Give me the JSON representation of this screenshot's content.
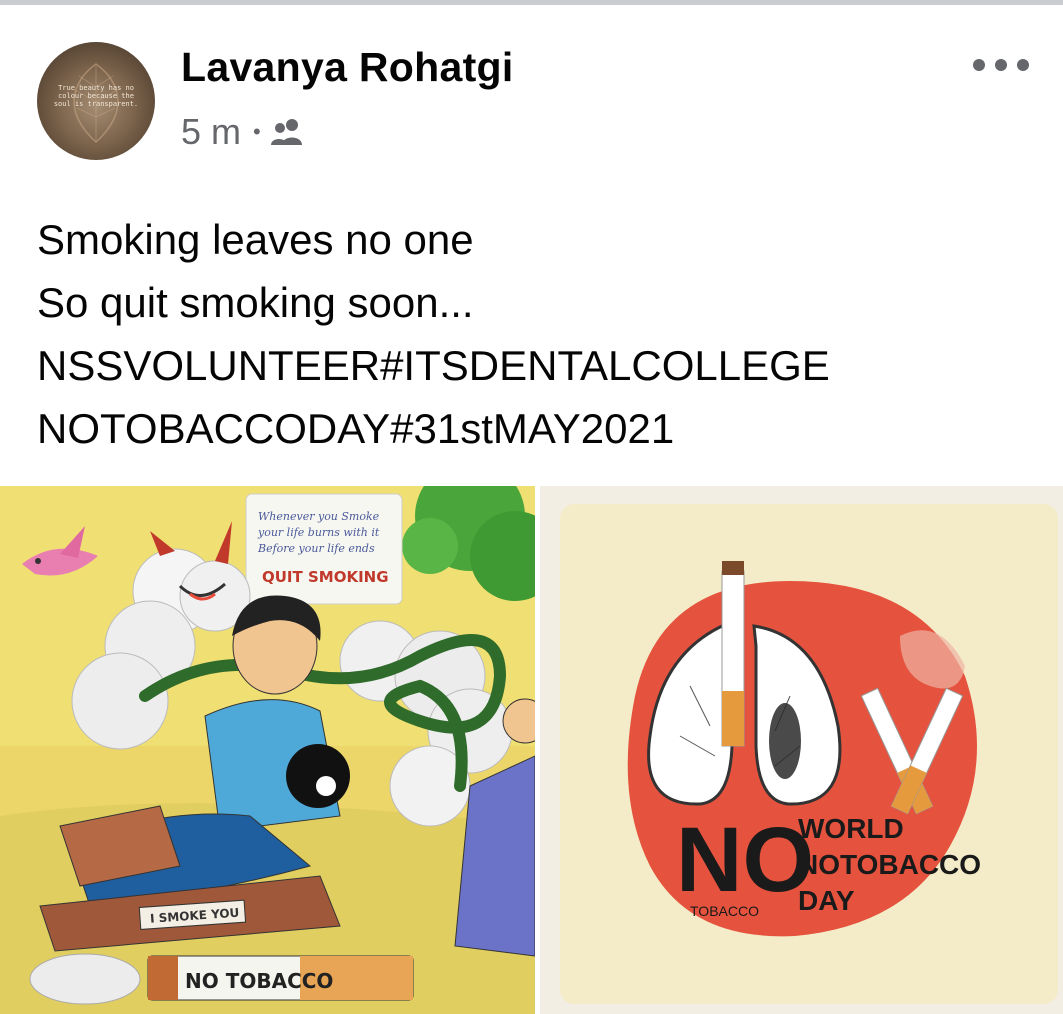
{
  "post": {
    "author": "Lavanya Rohatgi",
    "time": "5 m",
    "separator": "•",
    "audience_icon": "friends-icon",
    "more_icon": "more-options-icon",
    "avatar_quote": "True beauty has no colour because the soul is transparent.",
    "text_lines": [
      "Smoking leaves no one",
      "So quit smoking soon...",
      "NSSVOLUNTEER#ITSDENTALCOLLEGE",
      "NOTOBACCODAY#31stMAY2021"
    ]
  },
  "photos": {
    "drawing": {
      "quote_lines": [
        "Whenever you Smoke",
        "your life burns with it",
        "Before your life ends"
      ],
      "headline": "QUIT SMOKING",
      "sign_smoke": "I SMOKE YOU",
      "sign_tobacco": "NO TOBACCO"
    },
    "poster": {
      "no": "NO",
      "tobacco": "TOBACCO",
      "title_lines": [
        "WORLD",
        "NOTOBACCO",
        "DAY"
      ]
    }
  },
  "colors": {
    "text": "#050505",
    "secondary": "#65676b",
    "poster_red": "#e5533e",
    "poster_bg": "#f3eee3"
  }
}
